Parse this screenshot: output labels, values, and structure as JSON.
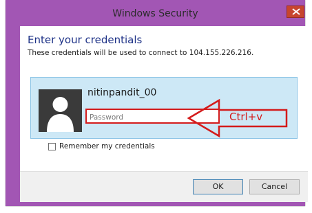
{
  "window": {
    "title": "Windows Security"
  },
  "dialog": {
    "heading": "Enter your credentials",
    "description": "These credentials will be used to connect to 104.155.226.216."
  },
  "credential_tile": {
    "username": "nitinpandit_00",
    "password_placeholder": "Password",
    "password_value": ""
  },
  "annotation": {
    "label": "Ctrl+v",
    "color": "#d41b1b"
  },
  "remember": {
    "label": "Remember my credentials",
    "checked": false
  },
  "buttons": {
    "ok_label": "OK",
    "cancel_label": "Cancel"
  },
  "colors": {
    "frame": "#a256b4",
    "close_button": "#c7452e",
    "tile_background": "#cde8f6",
    "heading": "#1e3287"
  },
  "icons": {
    "close": "close-icon",
    "avatar": "user-avatar-icon",
    "annotation_arrow": "left-arrow-annotation"
  }
}
